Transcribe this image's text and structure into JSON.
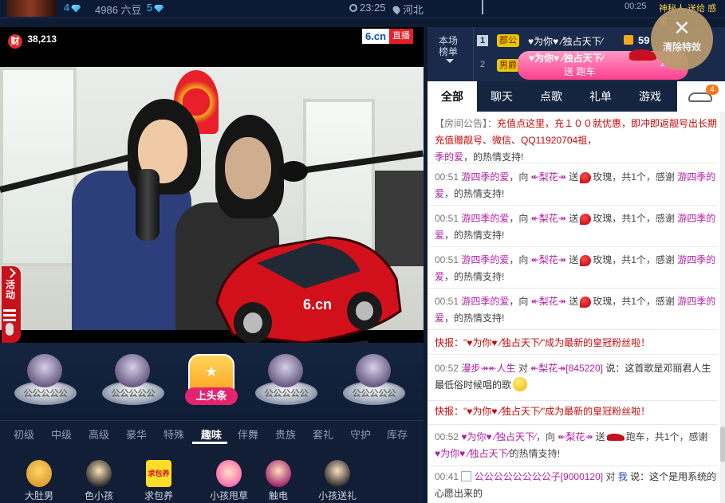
{
  "topbar": {
    "gem_a": "4",
    "beans": "4986 六豆",
    "gem_b": "5",
    "time": "23:25",
    "location": "河北",
    "right_time": "00:25",
    "right_text": "神秘人 送给 感谢"
  },
  "video": {
    "wealth_icon": "财",
    "wealth_count": "38,213",
    "logo": "6.cn",
    "live": "直播",
    "car_brand": "6.cn"
  },
  "side_tab": {
    "label": "活动"
  },
  "gift_slots": [
    {
      "label": "公公公公公"
    },
    {
      "label": "公公公公公"
    },
    {
      "label": "上头条"
    },
    {
      "label": "公公公公公"
    },
    {
      "label": "公公公公公"
    }
  ],
  "gift_tabs": [
    "初级",
    "中级",
    "高级",
    "豪华",
    "特殊",
    "趣味",
    "伴舞",
    "贵族",
    "套礼",
    "守护",
    "库存"
  ],
  "gift_tab_active": "趣味",
  "gift_items": [
    {
      "name": "大肚男"
    },
    {
      "name": "色小孩"
    },
    {
      "name": "求包养",
      "tag": "求包养"
    },
    {
      "name": "小孩甩草"
    },
    {
      "name": "触电"
    },
    {
      "name": "小孩送礼"
    }
  ],
  "rank": {
    "label_line1": "本场",
    "label_line2": "榜单",
    "row1_no": "1",
    "row1_badge": "郡公",
    "row1_name": "♥为你♥ ⁄独占天下⁄",
    "row1_amount": "59",
    "row2_no": "2",
    "row2_badge": "男爵"
  },
  "car_banner": {
    "sender": "♥为你♥ ⁄独占天下⁄",
    "action": "送 跑车",
    "count": "1个"
  },
  "clear_fx": {
    "label": "清除特效"
  },
  "chat_tabs": [
    "全部",
    "聊天",
    "点歌",
    "礼单",
    "游戏"
  ],
  "chat_tab_active": "全部",
  "car_badge_count": "4",
  "chat": {
    "notice_tag": "【房间公告】：",
    "notice_text": "充值点这里，充１００就优惠，即冲即返靓号出长期充值赠靓号、微信、QQ11920704祖，",
    "notice_name": "季的爱",
    "notice_tail": "，的热情支持!",
    "gift_rows": [
      {
        "time": "00:51",
        "from": "游四季的爱",
        "to": "↞梨花↠",
        "gift": "玫瑰",
        "count": "，共1个，感谢",
        "thanks": "游四季的爱",
        "tail": "，的热情支持!"
      },
      {
        "time": "00:51",
        "from": "游四季的爱",
        "to": "↞梨花↠",
        "gift": "玫瑰",
        "count": "，共1个，感谢",
        "thanks": "游四季的爱",
        "tail": "，的热情支持!"
      },
      {
        "time": "00:51",
        "from": "游四季的爱",
        "to": "↞梨花↠",
        "gift": "玫瑰",
        "count": "，共1个，感谢",
        "thanks": "游四季的爱",
        "tail": "，的热情支持!"
      },
      {
        "time": "00:51",
        "from": "游四季的爱",
        "to": "↞梨花↠",
        "gift": "玫瑰",
        "count": "，共1个，感谢",
        "thanks": "游四季的爱",
        "tail": "，的热情支持!"
      }
    ],
    "flash1_tag": "快报：",
    "flash1_text": "\"♥为你♥ ⁄独占天下⁄\"成为最新的皇冠粉丝啦！",
    "say1_time": "00:52",
    "say1_from": "漫步↠↞人生",
    "say1_to": "↞梨花↠[845220]",
    "say1_text": "说：这首歌是邓丽君人生最低俗时候唱的歌",
    "flash2_tag": "快报：",
    "flash2_text": "\"♥为你♥ ⁄独占天下⁄\"成为最新的皇冠粉丝啦！",
    "car_time": "00:52",
    "car_from": "♥为你♥ ⁄独占天下⁄",
    "car_to": "↞梨花↠",
    "car_gift": "跑车",
    "car_count": "，共1个，感谢",
    "car_thanks": "♥为你♥ ⁄独占天下⁄",
    "car_tail": "的热情支持!",
    "say2_time": "00:41",
    "say2_from": "公公公公公公公公子[9000120]",
    "say2_to": "我",
    "say2_text": "说：这个是用系统的心愿出来的"
  }
}
